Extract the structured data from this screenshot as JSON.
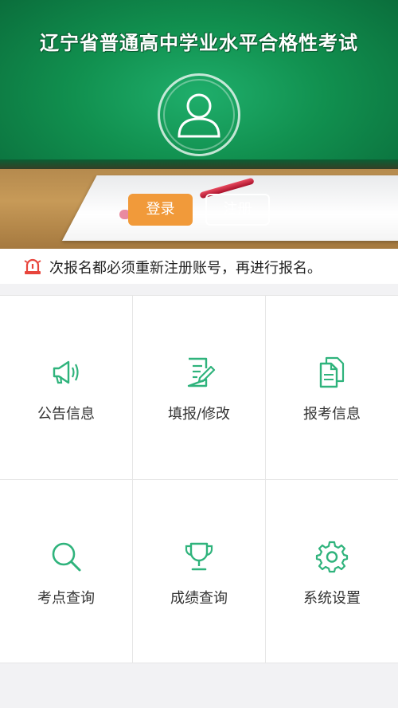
{
  "banner": {
    "title": "辽宁省普通高中学业水平合格性考试",
    "login_label": "登录",
    "register_label": "注册",
    "avatar_icon": "user-avatar-icon"
  },
  "notice": {
    "icon": "alarm-siren-icon",
    "text": "次报名都必须重新注册账号，再进行报名。"
  },
  "menu": [
    {
      "label": "公告信息",
      "icon": "megaphone-icon"
    },
    {
      "label": "填报/修改",
      "icon": "edit-form-icon"
    },
    {
      "label": "报考信息",
      "icon": "documents-icon"
    },
    {
      "label": "考点查询",
      "icon": "search-icon"
    },
    {
      "label": "成绩查询",
      "icon": "trophy-icon"
    },
    {
      "label": "系统设置",
      "icon": "gear-icon"
    }
  ],
  "colors": {
    "accent": "#2fb37c",
    "login_button": "#f19a3a",
    "notice_icon": "#e8453c"
  }
}
